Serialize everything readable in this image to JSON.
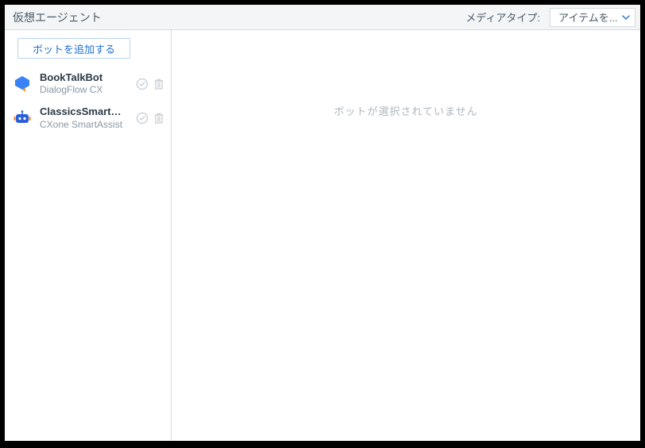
{
  "header": {
    "title": "仮想エージェント",
    "media_type_label": "メディアタイプ:",
    "dropdown_text": "アイテムを..."
  },
  "sidebar": {
    "add_button_label": "ボットを追加する",
    "items": [
      {
        "title": "BookTalkBot",
        "subtitle": "DialogFlow CX",
        "icon": "dialogflow"
      },
      {
        "title": "ClassicsSmartSupport",
        "subtitle": "CXone SmartAssist",
        "icon": "smartassist"
      }
    ]
  },
  "main": {
    "empty_message": "ボットが選択されていません"
  }
}
